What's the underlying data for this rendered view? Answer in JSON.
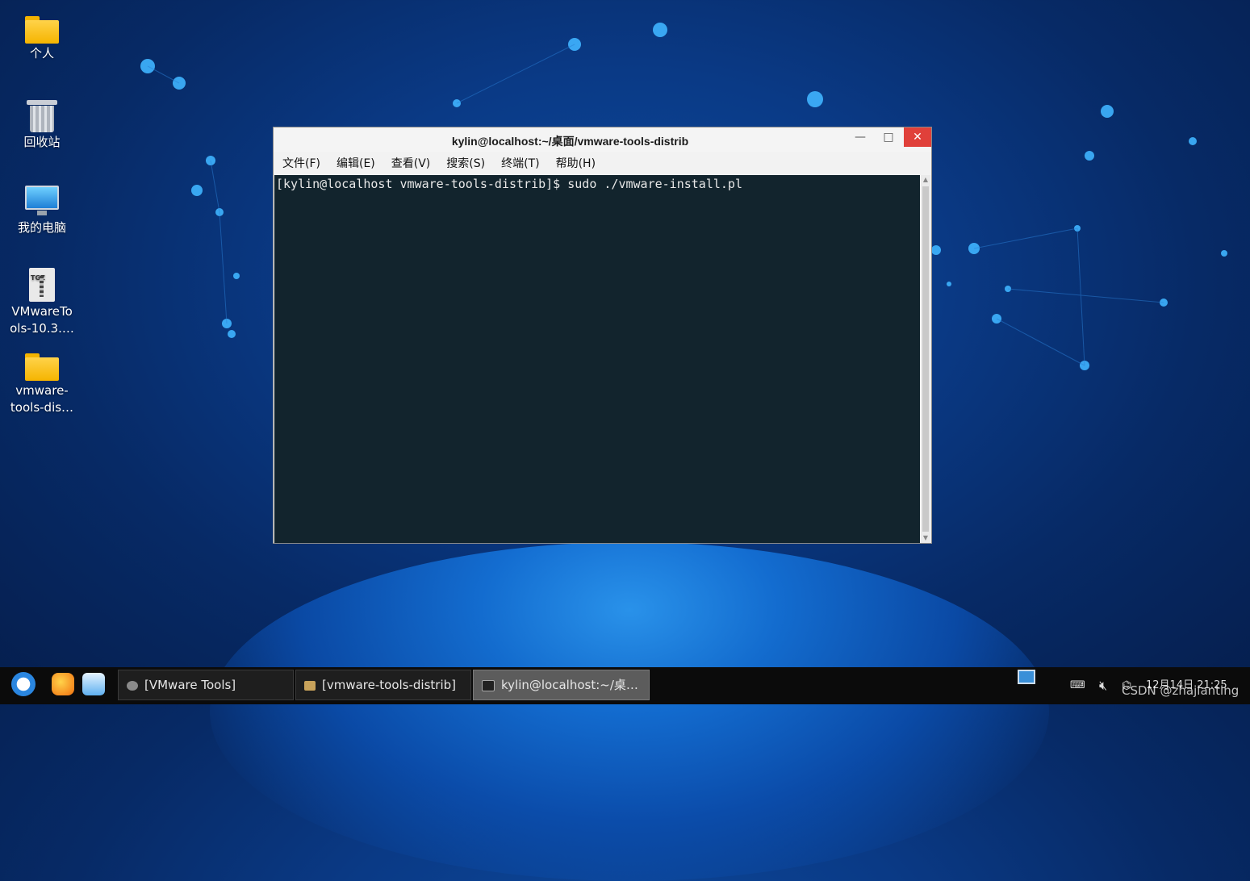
{
  "desktop": {
    "icons": [
      {
        "label": "个人",
        "icon": "home-folder-icon"
      },
      {
        "label": "回收站",
        "icon": "trash-icon"
      },
      {
        "label": "我的电脑",
        "icon": "computer-icon"
      },
      {
        "label": "VMwareTo ols-10.3.…",
        "icon": "tgz-archive-icon"
      },
      {
        "label": "vmware- tools-dis…",
        "icon": "folder-icon"
      }
    ]
  },
  "window": {
    "title": "kylin@localhost:~/桌面/vmware-tools-distrib",
    "buttons": {
      "minimize": "—",
      "maximize": "□",
      "close": "✕"
    },
    "menu": [
      "文件(F)",
      "编辑(E)",
      "查看(V)",
      "搜索(S)",
      "终端(T)",
      "帮助(H)"
    ],
    "terminal": {
      "line": "[kylin@localhost vmware-tools-distrib]$ sudo ./vmware-install.pl"
    }
  },
  "taskbar": {
    "tasks": [
      {
        "label": "[VMware Tools]",
        "active": false
      },
      {
        "label": "[vmware-tools-distrib]",
        "active": false
      },
      {
        "label": "kylin@localhost:~/桌…",
        "active": true
      }
    ],
    "clock": "12月14日 21:25",
    "watermark": "CSDN @zhajianting"
  }
}
